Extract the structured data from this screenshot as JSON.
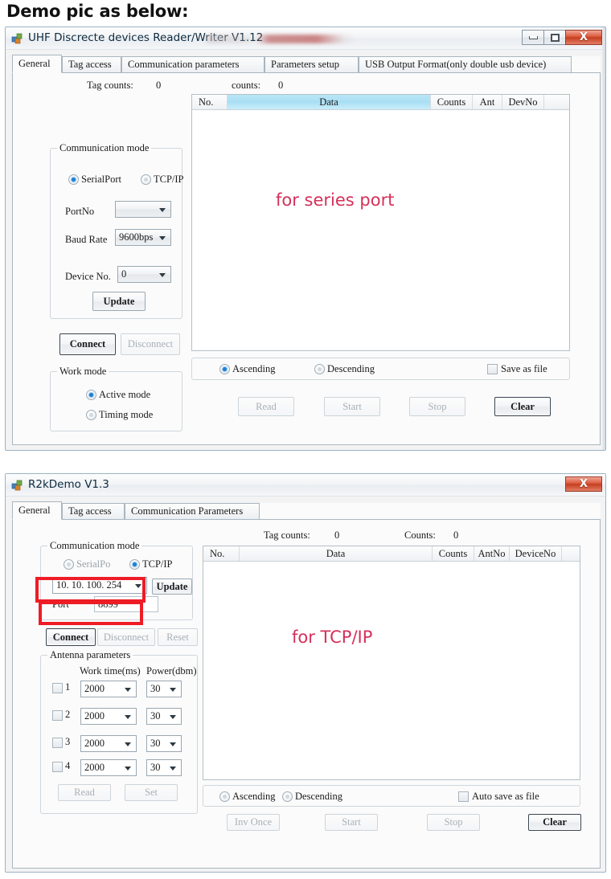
{
  "page": {
    "heading": "Demo pic as below:"
  },
  "accent": {
    "note_pink": "#d6305a",
    "annotation_red": "#ee1c25",
    "grid_highlight": "#a9dff3"
  },
  "window1": {
    "title": "UHF Discrecte devices Reader/Writer V1.12",
    "icon": "app-icon",
    "buttons": {
      "minimize": "minimize-icon",
      "maximize": "maximize-icon",
      "close": "X"
    },
    "tabs": [
      {
        "label": "General",
        "active": true
      },
      {
        "label": "Tag access",
        "active": false
      },
      {
        "label": "Communication parameters",
        "active": false
      },
      {
        "label": "Parameters setup",
        "active": false
      },
      {
        "label": "USB Output Format(only double usb device)",
        "active": false
      }
    ],
    "comm_group": {
      "legend": "Communication mode",
      "radios": [
        {
          "label": "SerialPort",
          "selected": true
        },
        {
          "label": "TCP/IP",
          "selected": false
        }
      ],
      "fields": [
        {
          "label": "PortNo",
          "value": "",
          "type": "combobox"
        },
        {
          "label": "Baud Rate",
          "value": "9600bps",
          "type": "combobox"
        },
        {
          "label": "Device No.",
          "value": "0",
          "type": "combobox"
        }
      ],
      "update_button": "Update"
    },
    "connect_button": "Connect",
    "disconnect_button": "Disconnect",
    "work_group": {
      "legend": "Work mode",
      "radios": [
        {
          "label": "Active mode",
          "selected": true
        },
        {
          "label": "Timing mode",
          "selected": false
        }
      ]
    },
    "counters": {
      "tag_counts_label": "Tag counts:",
      "tag_counts_value": "0",
      "counts_label": "counts:",
      "counts_value": "0"
    },
    "grid": {
      "columns": [
        "No.",
        "Data",
        "Counts",
        "Ant",
        "DevNo"
      ],
      "highlight_column": "Data",
      "rows": [],
      "watermark": "for series port"
    },
    "sortbar": {
      "ascending": {
        "label": "Ascending",
        "selected": true
      },
      "descending": {
        "label": "Descending",
        "selected": false
      },
      "save_checkbox": {
        "label": "Save as file",
        "checked": false
      }
    },
    "actions": [
      {
        "label": "Read",
        "enabled": false
      },
      {
        "label": "Start",
        "enabled": false
      },
      {
        "label": "Stop",
        "enabled": false
      },
      {
        "label": "Clear",
        "enabled": true,
        "default": true
      }
    ]
  },
  "window2": {
    "title": "R2kDemo V1.3",
    "icon": "app-icon",
    "buttons": {
      "close": "X"
    },
    "tabs": [
      {
        "label": "General",
        "active": true
      },
      {
        "label": "Tag access",
        "active": false
      },
      {
        "label": "Communication Parameters",
        "active": false
      }
    ],
    "comm_group": {
      "legend": "Communication mode",
      "radios": [
        {
          "label": "SerialPo",
          "selected": false
        },
        {
          "label": "TCP/IP",
          "selected": true
        }
      ],
      "ip_value": "10. 10. 100. 254",
      "update_button": "Update",
      "port_label": "Port",
      "port_value": "8899"
    },
    "connect_button": "Connect",
    "disconnect_button": "Disconnect",
    "reset_button": "Reset",
    "antenna_group": {
      "legend": "Antenna parameters",
      "col_worktime": "Work time(ms)",
      "col_power": "Power(dbm)",
      "rows": [
        {
          "index": "1",
          "checked": false,
          "worktime": "2000",
          "power": "30"
        },
        {
          "index": "2",
          "checked": false,
          "worktime": "2000",
          "power": "30"
        },
        {
          "index": "3",
          "checked": false,
          "worktime": "2000",
          "power": "30"
        },
        {
          "index": "4",
          "checked": false,
          "worktime": "2000",
          "power": "30"
        }
      ],
      "read_button": "Read",
      "set_button": "Set"
    },
    "counters": {
      "tag_counts_label": "Tag counts:",
      "tag_counts_value": "0",
      "counts_label": "Counts:",
      "counts_value": "0"
    },
    "grid": {
      "columns": [
        "No.",
        "Data",
        "Counts",
        "AntNo",
        "DeviceNo"
      ],
      "highlight_column": "",
      "rows": [],
      "watermark": "for TCP/IP"
    },
    "sortbar": {
      "ascending": {
        "label": "Ascending",
        "selected": false
      },
      "descending": {
        "label": "Descending",
        "selected": false
      },
      "save_checkbox": {
        "label": "Auto save as file",
        "checked": false
      }
    },
    "actions": [
      {
        "label": "Inv Once",
        "enabled": false
      },
      {
        "label": "Start",
        "enabled": false
      },
      {
        "label": "Stop",
        "enabled": false
      },
      {
        "label": "Clear",
        "enabled": true,
        "default": true
      }
    ]
  }
}
